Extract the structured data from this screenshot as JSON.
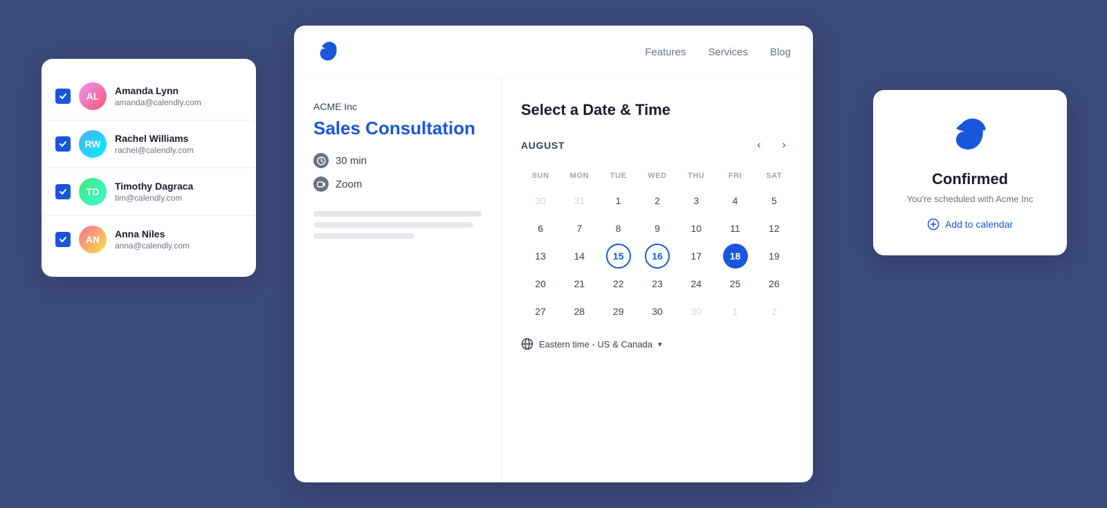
{
  "contacts_card": {
    "contacts": [
      {
        "name": "Amanda Lynn",
        "email": "amanda@calendly.com",
        "initials": "AL",
        "av_class": "av-1"
      },
      {
        "name": "Rachel Williams",
        "email": "rachel@calendly.com",
        "initials": "RW",
        "av_class": "av-2"
      },
      {
        "name": "Timothy Dagraca",
        "email": "tim@calendly.com",
        "initials": "TD",
        "av_class": "av-3"
      },
      {
        "name": "Anna Niles",
        "email": "anna@calendly.com",
        "initials": "AN",
        "av_class": "av-4"
      }
    ]
  },
  "nav": {
    "features": "Features",
    "services": "Services",
    "blog": "Blog"
  },
  "event": {
    "company": "ACME Inc",
    "title": "Sales Consultation",
    "duration": "30 min",
    "platform": "Zoom"
  },
  "calendar": {
    "select_label": "Select a Date & Time",
    "month": "AUGUST",
    "day_headers": [
      "SUN",
      "MON",
      "TUE",
      "WED",
      "THU",
      "FRI",
      "SAT"
    ],
    "rows": [
      [
        "30",
        "31",
        "1",
        "2",
        "3",
        "4",
        "5"
      ],
      [
        "6",
        "7",
        "8",
        "9",
        "10",
        "11",
        "12"
      ],
      [
        "13",
        "14",
        "15",
        "16",
        "17",
        "18",
        "19"
      ],
      [
        "20",
        "21",
        "22",
        "23",
        "24",
        "25",
        "26"
      ],
      [
        "27",
        "28",
        "29",
        "30",
        "30",
        "1",
        "2"
      ]
    ],
    "other_month_start": [
      "30",
      "31"
    ],
    "other_month_end": [
      "30",
      "1",
      "2"
    ],
    "available_ring": [
      "15",
      "16"
    ],
    "selected": [
      "18"
    ],
    "timezone": "Eastern time - US & Canada"
  },
  "confirmed": {
    "title": "Confirmed",
    "subtitle": "You're scheduled with Acme Inc",
    "add_calendar": "Add to calendar"
  }
}
